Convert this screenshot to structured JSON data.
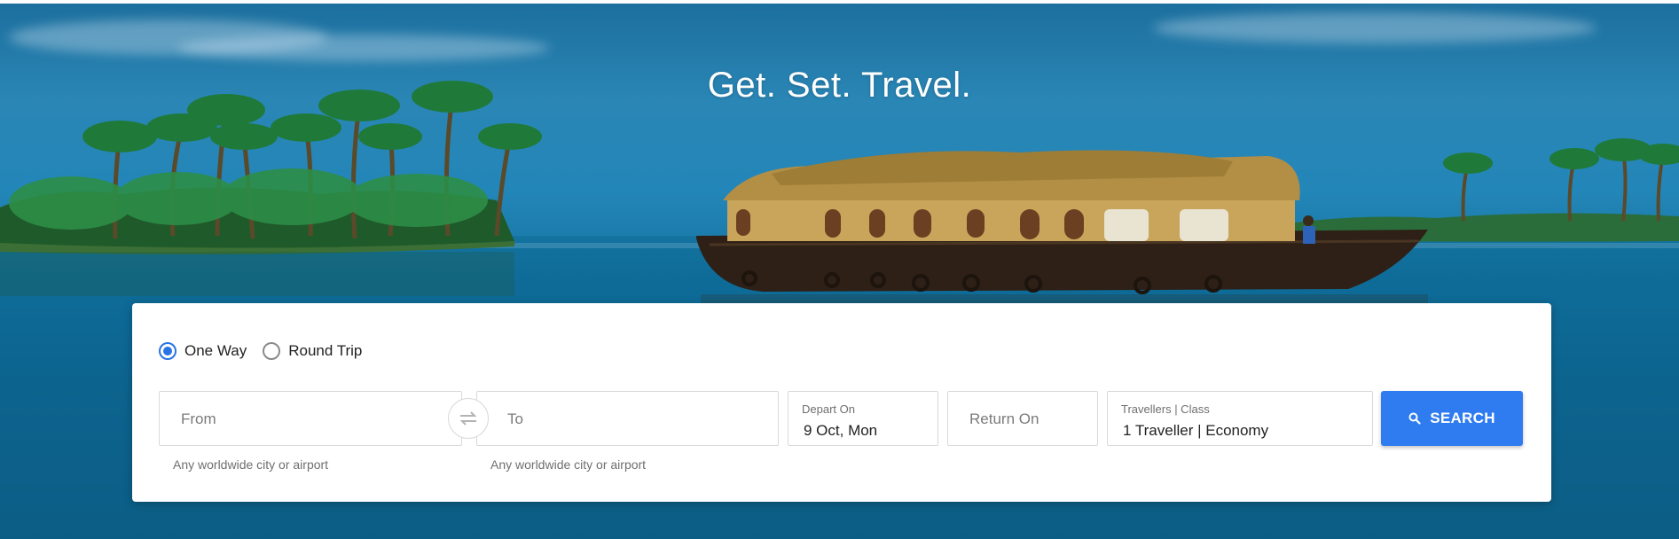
{
  "hero": {
    "headline": "Get. Set. Travel."
  },
  "trip_type": {
    "options": [
      {
        "label": "One Way",
        "checked": true
      },
      {
        "label": "Round Trip",
        "checked": false
      }
    ]
  },
  "from": {
    "placeholder": "From",
    "hint": "Any worldwide city or airport"
  },
  "to": {
    "placeholder": "To",
    "hint": "Any worldwide city or airport"
  },
  "swap_icon": "swap-arrows-icon",
  "depart": {
    "label": "Depart On",
    "value": "9 Oct, Mon"
  },
  "return": {
    "placeholder": "Return On"
  },
  "travellers": {
    "label": "Travellers | Class",
    "value": "1 Traveller | Economy"
  },
  "search": {
    "label": "SEARCH",
    "icon": "search-icon"
  },
  "colors": {
    "accent": "#2f7bf0",
    "radio_checked": "#2873e6"
  }
}
